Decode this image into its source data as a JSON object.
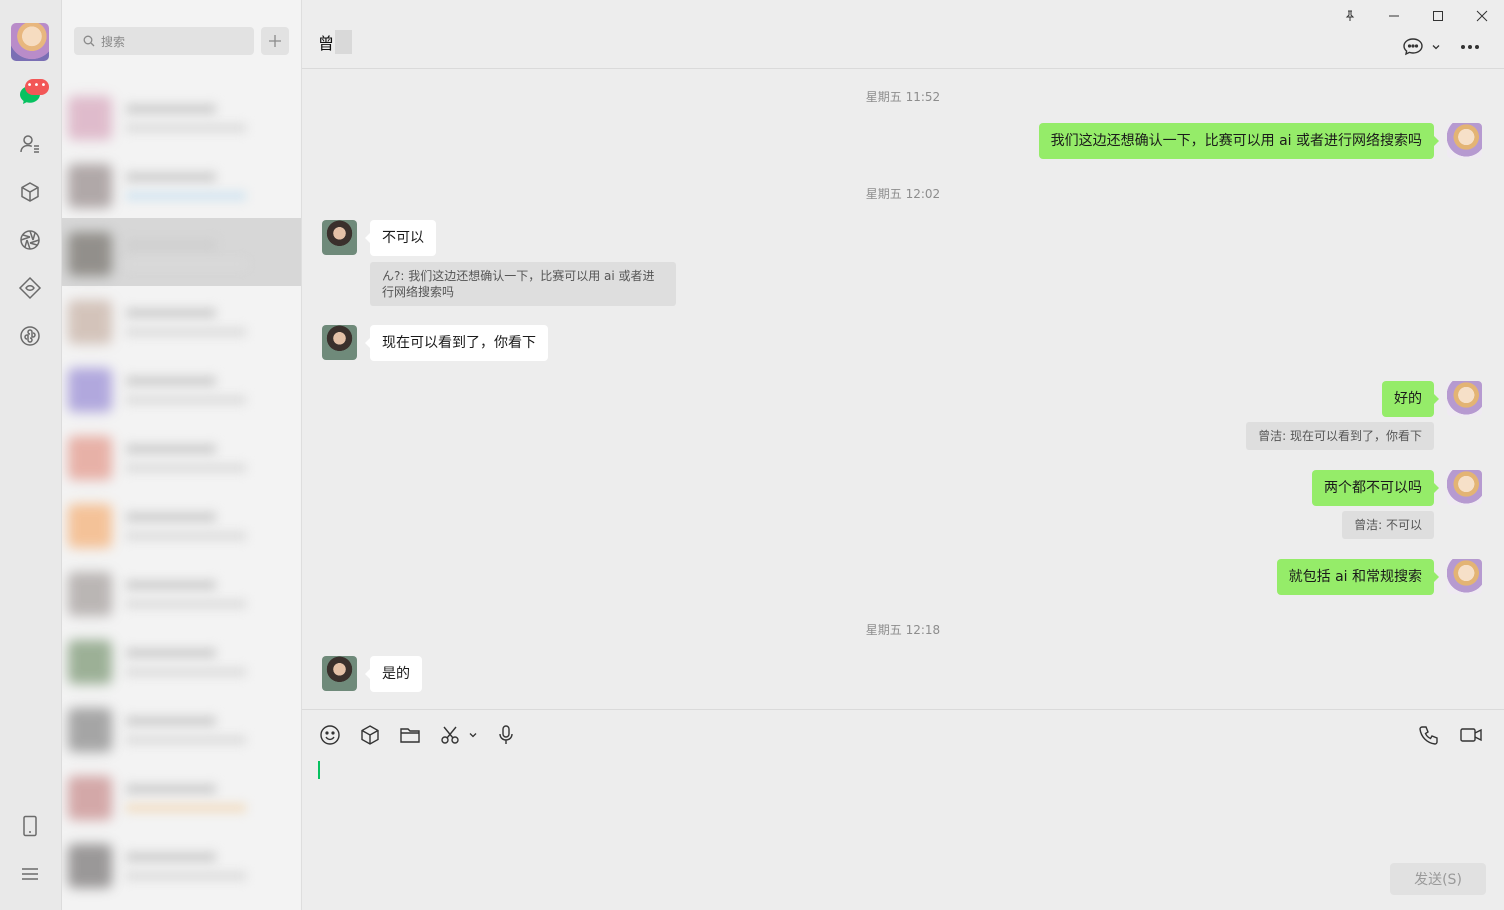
{
  "rail": {
    "items": [
      "chats",
      "contacts",
      "favorites",
      "moments",
      "channels",
      "mini-programs"
    ],
    "badge": "•••"
  },
  "list": {
    "search_placeholder": "搜索"
  },
  "chat": {
    "title": "曾",
    "messages": [
      {
        "type": "time",
        "text": "星期五 11:52"
      },
      {
        "type": "out",
        "text": "我们这边还想确认一下，比赛可以用 ai 或者进行网络搜索吗"
      },
      {
        "type": "time",
        "text": "星期五 12:02"
      },
      {
        "type": "in",
        "text": "不可以",
        "quote": "ん?: 我们这边还想确认一下，比赛可以用 ai 或者进行网络搜索吗"
      },
      {
        "type": "in",
        "text": "现在可以看到了，你看下"
      },
      {
        "type": "out",
        "text": "好的",
        "quote": "曾洁: 现在可以看到了，你看下"
      },
      {
        "type": "out",
        "text": "两个都不可以吗",
        "quote": "曾洁: 不可以"
      },
      {
        "type": "out",
        "text": "就包括 ai 和常规搜索"
      },
      {
        "type": "time",
        "text": "星期五 12:18"
      },
      {
        "type": "in",
        "text": "是的"
      }
    ]
  },
  "input": {
    "send_label": "发送(S)"
  },
  "colors": {
    "outgoing_bubble": "#95ec69",
    "incoming_bubble": "#ffffff",
    "badge": "#f25757",
    "caret": "#07c160"
  }
}
